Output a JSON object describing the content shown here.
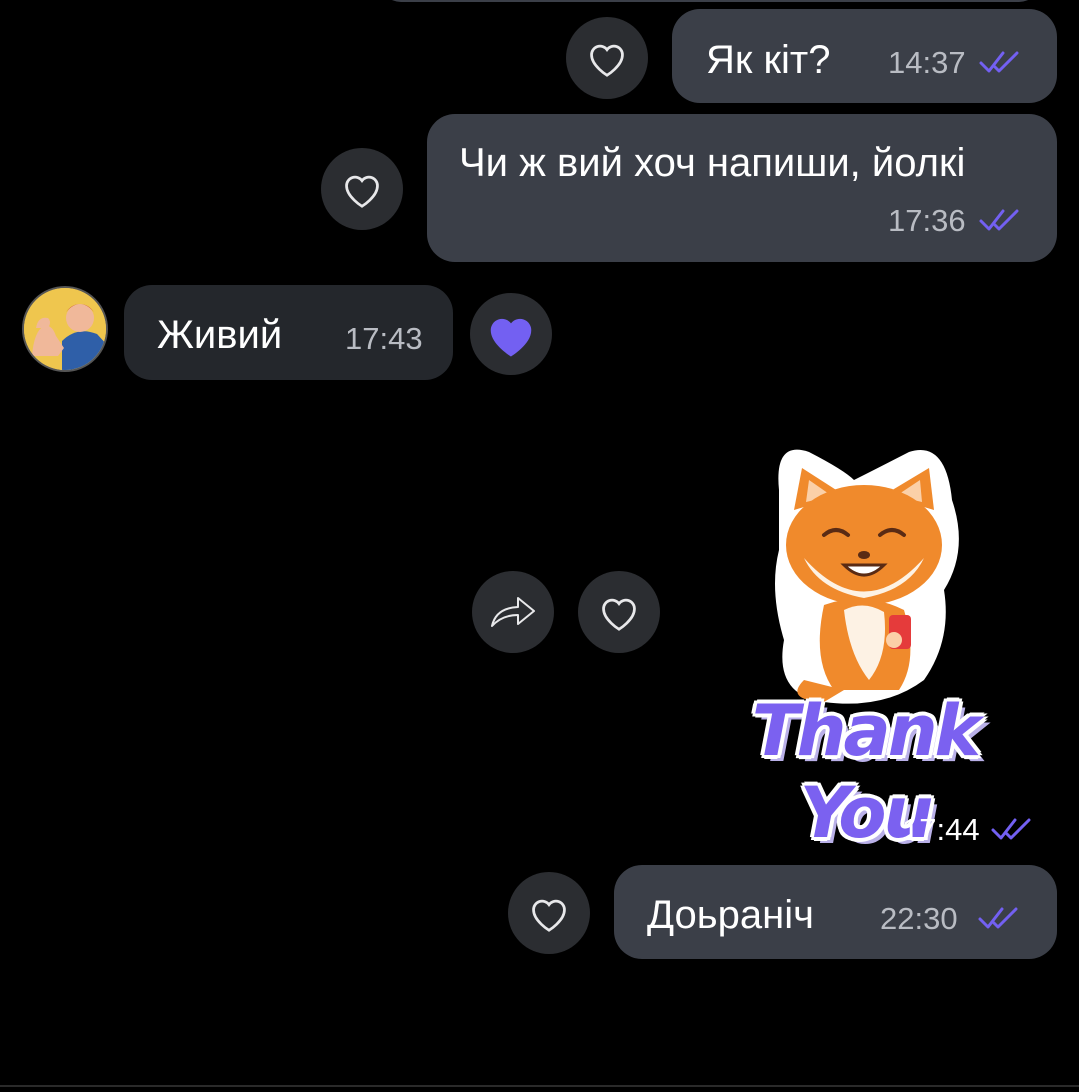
{
  "colors": {
    "background": "#000000",
    "outgoing_bubble": "#3b3f48",
    "incoming_bubble": "#24272c",
    "accent": "#7360f2",
    "time_text": "#b9bcc3"
  },
  "messages": [
    {
      "direction": "outgoing",
      "text": "Як кіт?",
      "time": "14:37",
      "status": "read",
      "reaction": "none"
    },
    {
      "direction": "outgoing",
      "text": "Чи ж вий хоч напиши, йолкі",
      "time": "17:36",
      "status": "read",
      "reaction": "none"
    },
    {
      "direction": "incoming",
      "text": "Живий",
      "time": "17:43",
      "reaction": "heart-filled",
      "avatar": "user-avatar"
    },
    {
      "direction": "outgoing",
      "type": "sticker",
      "sticker_text": "Thank You",
      "sticker_icon": "fox-sticker",
      "time": "17:44",
      "status": "read",
      "reaction": "none"
    },
    {
      "direction": "outgoing",
      "text": "Доьраніч",
      "time": "22:30",
      "status": "read",
      "reaction": "none"
    }
  ],
  "icons": {
    "like": "heart-outline-icon",
    "liked": "heart-filled-icon",
    "forward": "forward-icon",
    "read_status": "double-check-icon"
  }
}
